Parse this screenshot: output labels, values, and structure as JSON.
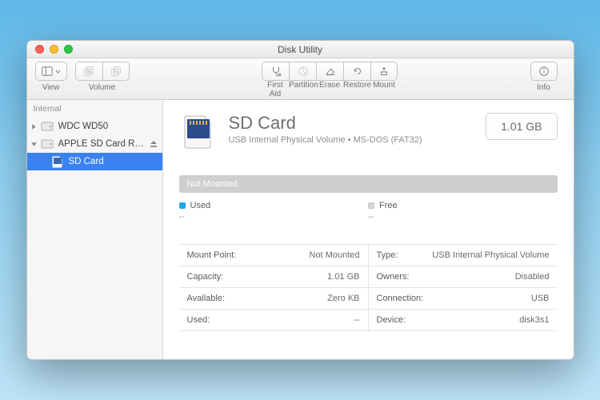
{
  "titlebar": {
    "title": "Disk Utility"
  },
  "toolbar": {
    "view": "View",
    "volume": "Volume",
    "first_aid": "First Aid",
    "partition": "Partition",
    "erase": "Erase",
    "restore": "Restore",
    "mount": "Mount",
    "info": "Info"
  },
  "sidebar": {
    "header": "Internal",
    "drive1": "WDC WD50",
    "drive2": "APPLE SD Card R…",
    "volume1": "SD Card"
  },
  "volume": {
    "name": "SD Card",
    "subtitle": "USB Internal Physical Volume • MS-DOS (FAT32)",
    "size": "1.01 GB",
    "status": "Not Mounted",
    "legend_used_label": "Used",
    "legend_used_value": "--",
    "legend_free_label": "Free",
    "legend_free_value": "--"
  },
  "info": {
    "mount_point_label": "Mount Point:",
    "mount_point_value": "Not Mounted",
    "capacity_label": "Capacity:",
    "capacity_value": "1.01 GB",
    "available_label": "Available:",
    "available_value": "Zero KB",
    "used_label": "Used:",
    "used_value": "--",
    "type_label": "Type:",
    "type_value": "USB Internal Physical Volume",
    "owners_label": "Owners:",
    "owners_value": "Disabled",
    "connection_label": "Connection:",
    "connection_value": "USB",
    "device_label": "Device:",
    "device_value": "disk3s1"
  }
}
